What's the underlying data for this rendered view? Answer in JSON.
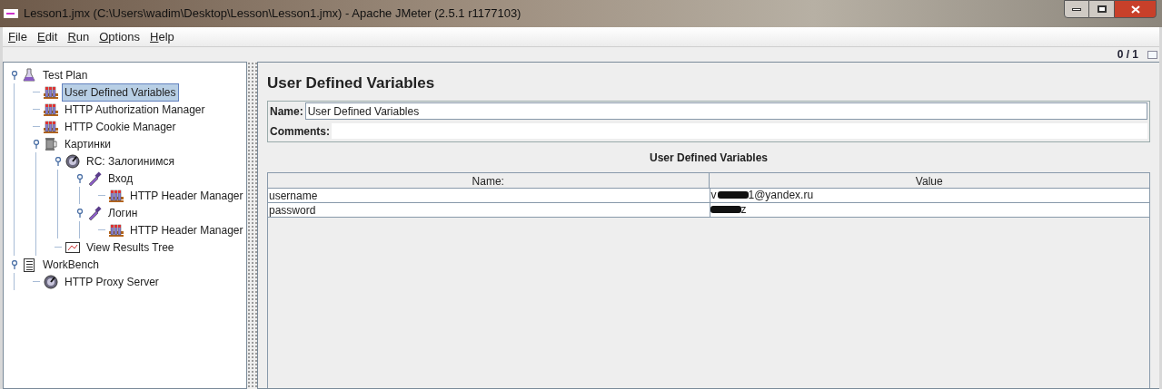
{
  "window": {
    "title": "Lesson1.jmx (C:\\Users\\wadim\\Desktop\\Lesson\\Lesson1.jmx) - Apache JMeter (2.5.1 r1177103)"
  },
  "menu": [
    {
      "label": "File"
    },
    {
      "label": "Edit"
    },
    {
      "label": "Run"
    },
    {
      "label": "Options"
    },
    {
      "label": "Help"
    }
  ],
  "toolbar": {
    "counter": "0 / 1"
  },
  "tree": [
    {
      "label": "Test Plan",
      "kind": "plan",
      "selected": false,
      "expanded": true,
      "children": [
        {
          "label": "User Defined Variables",
          "kind": "config",
          "selected": true
        },
        {
          "label": "HTTP Authorization Manager",
          "kind": "config",
          "selected": false
        },
        {
          "label": "HTTP Cookie Manager",
          "kind": "config",
          "selected": false
        },
        {
          "label": "Картинки",
          "kind": "threadgroup",
          "selected": false,
          "expanded": true,
          "children": [
            {
              "label": "RC: Залогинимся",
              "kind": "controller",
              "selected": false,
              "expanded": true,
              "children": [
                {
                  "label": "Вход",
                  "kind": "sampler",
                  "selected": false,
                  "expanded": true,
                  "children": [
                    {
                      "label": "HTTP Header Manager",
                      "kind": "config",
                      "selected": false
                    }
                  ]
                },
                {
                  "label": "Логин",
                  "kind": "sampler",
                  "selected": false,
                  "expanded": true,
                  "children": [
                    {
                      "label": "HTTP Header Manager",
                      "kind": "config",
                      "selected": false
                    }
                  ]
                }
              ]
            },
            {
              "label": "View Results Tree",
              "kind": "listener",
              "selected": false
            }
          ]
        }
      ]
    },
    {
      "label": "WorkBench",
      "kind": "workbench",
      "selected": false,
      "expanded": true,
      "children": [
        {
          "label": "HTTP Proxy Server",
          "kind": "controller",
          "selected": false
        }
      ]
    }
  ],
  "panel": {
    "title": "User Defined Variables",
    "name_label": "Name:",
    "name_value": "User Defined Variables",
    "comments_label": "Comments:",
    "table": {
      "title": "User Defined Variables",
      "columns": [
        "Name:",
        "Value"
      ],
      "rows": [
        {
          "name": "username",
          "value_start": "v",
          "redacted": true,
          "value_end": "1@yandex.ru"
        },
        {
          "name": "password",
          "redacted": true,
          "value_end": "z"
        }
      ]
    }
  }
}
